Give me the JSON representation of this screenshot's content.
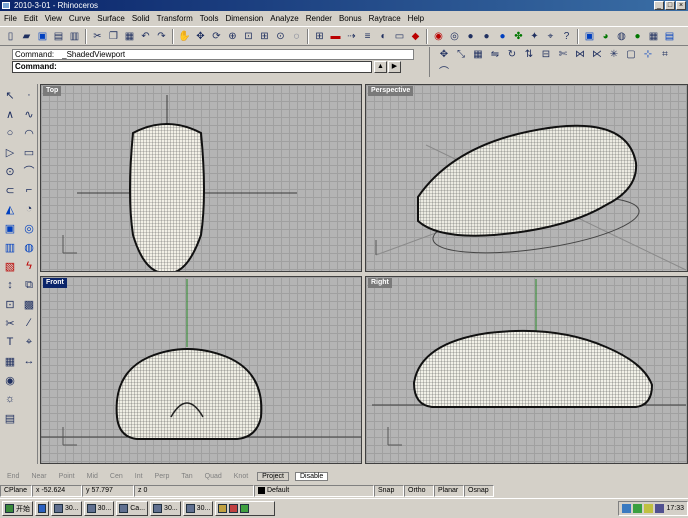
{
  "window": {
    "title": "2010-3-01 - Rhinoceros"
  },
  "menu": [
    "File",
    "Edit",
    "View",
    "Curve",
    "Surface",
    "Solid",
    "Transform",
    "Tools",
    "Dimension",
    "Analyze",
    "Render",
    "Bonus",
    "Raytrace",
    "Help"
  ],
  "command": {
    "history_label": "Command:",
    "history_value": "_ShadedViewport",
    "prompt_label": "Command:",
    "input_value": ""
  },
  "viewports": {
    "top": "Top",
    "perspective": "Perspective",
    "front": "Front",
    "right": "Right"
  },
  "viewport_tabs": [
    "End",
    "Near",
    "Point",
    "Mid",
    "Cen",
    "Int",
    "Perp",
    "Tan",
    "Quad",
    "Knot"
  ],
  "bottom_buttons": {
    "project": "Project",
    "disable": "Disable"
  },
  "status": {
    "cplane": "CPlane",
    "x": "x -52.624",
    "y": "y 57.797",
    "z": "z 0",
    "layer": "Default",
    "snap": "Snap",
    "ortho": "Ortho",
    "planar": "Planar",
    "osnap": "Osnap"
  },
  "taskbar": {
    "start": "开始",
    "tasks": [
      "30...",
      "30...",
      "Ca...",
      "30...",
      "30..."
    ],
    "clock": "17:33"
  }
}
